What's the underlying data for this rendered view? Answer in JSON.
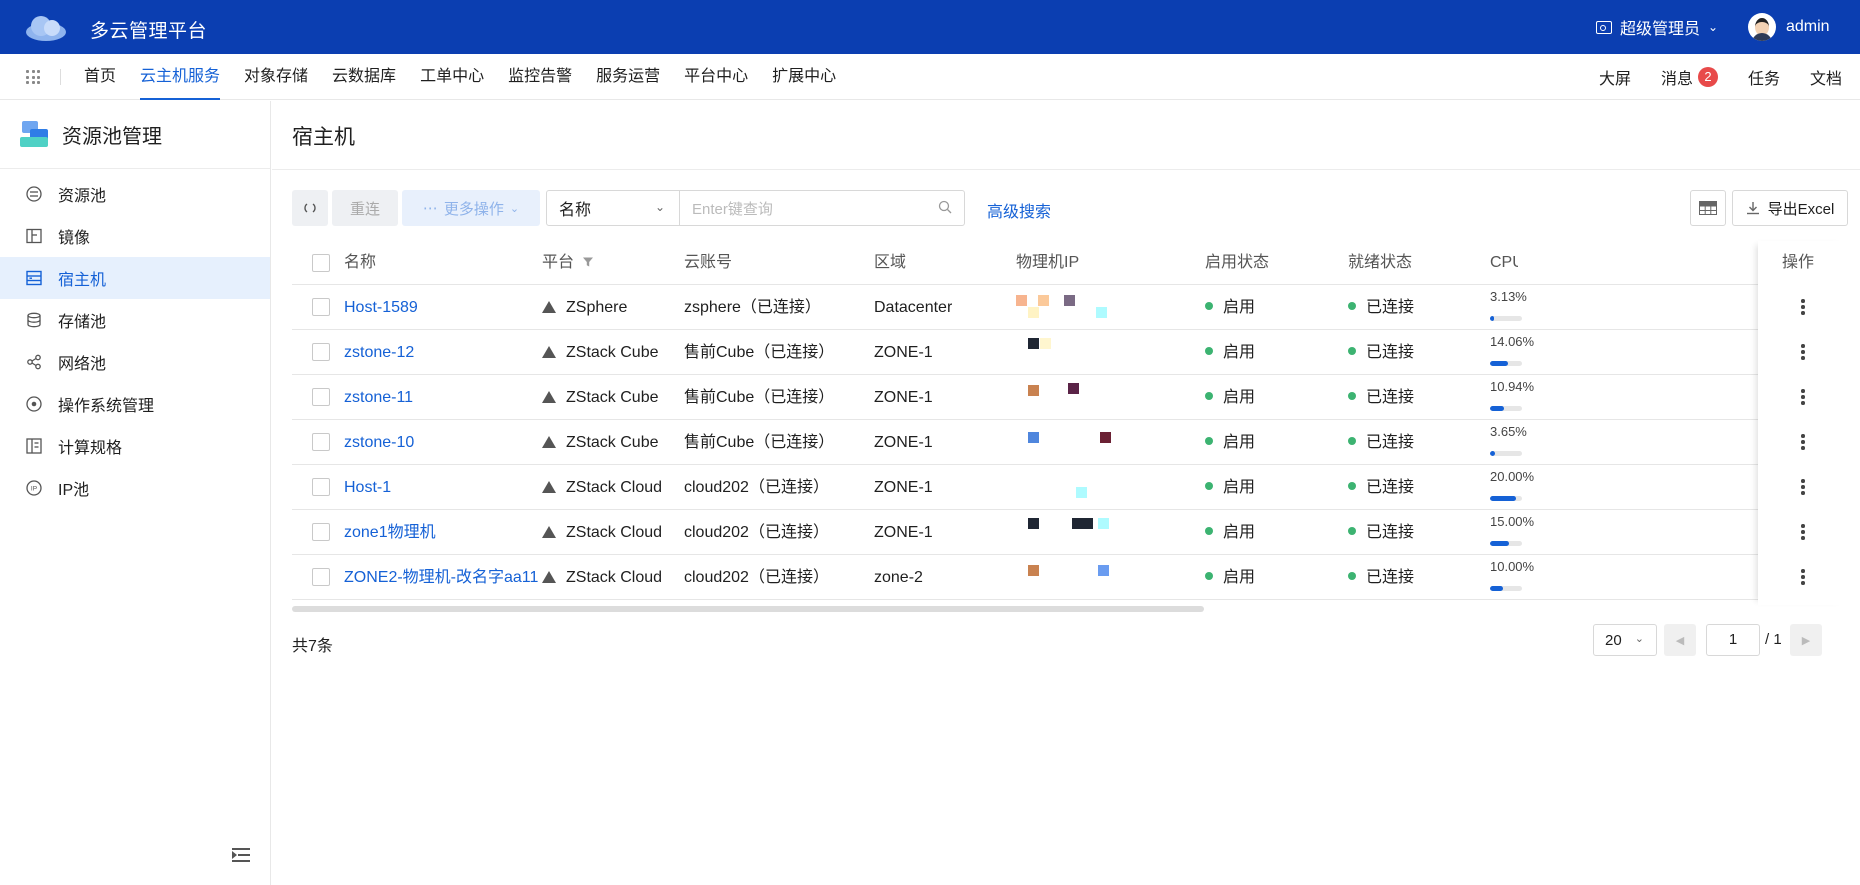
{
  "app": {
    "title": "多云管理平台",
    "role": "超级管理员",
    "user": "admin"
  },
  "nav": {
    "items": [
      "首页",
      "云主机服务",
      "对象存储",
      "云数据库",
      "工单中心",
      "监控告警",
      "服务运营",
      "平台中心",
      "扩展中心"
    ],
    "active_index": 1,
    "right": {
      "screen": "大屏",
      "messages": "消息",
      "message_count": "2",
      "tasks": "任务",
      "docs": "文档"
    }
  },
  "sidebar": {
    "title": "资源池管理",
    "items": [
      {
        "label": "资源池",
        "icon": "resource-pool-icon"
      },
      {
        "label": "镜像",
        "icon": "image-icon"
      },
      {
        "label": "宿主机",
        "icon": "host-icon"
      },
      {
        "label": "存储池",
        "icon": "storage-icon"
      },
      {
        "label": "网络池",
        "icon": "network-icon"
      },
      {
        "label": "操作系统管理",
        "icon": "os-icon"
      },
      {
        "label": "计算规格",
        "icon": "spec-icon"
      },
      {
        "label": "IP池",
        "icon": "ip-icon"
      }
    ],
    "active_index": 2
  },
  "page": {
    "title": "宿主机",
    "toolbar": {
      "reconnect": "重连",
      "more_actions": "更多操作",
      "search_field": "名称",
      "search_placeholder": "Enter键查询",
      "advanced_search": "高级搜索",
      "export": "导出Excel"
    },
    "table": {
      "columns": [
        "名称",
        "平台",
        "云账号",
        "区域",
        "物理机IP",
        "启用状态",
        "就绪状态",
        "CPU",
        "操作"
      ],
      "rows": [
        {
          "name": "Host-1589",
          "platform": "ZSphere",
          "account": "zsphere（已连接）",
          "zone": "Datacenter",
          "enabled": "启用",
          "ready": "已连接",
          "cpu": "3.13%",
          "cpu_pct": 3.13
        },
        {
          "name": "zstone-12",
          "platform": "ZStack Cube",
          "account": "售前Cube（已连接）",
          "zone": "ZONE-1",
          "enabled": "启用",
          "ready": "已连接",
          "cpu": "14.06%",
          "cpu_pct": 14.06
        },
        {
          "name": "zstone-11",
          "platform": "ZStack Cube",
          "account": "售前Cube（已连接）",
          "zone": "ZONE-1",
          "enabled": "启用",
          "ready": "已连接",
          "cpu": "10.94%",
          "cpu_pct": 10.94
        },
        {
          "name": "zstone-10",
          "platform": "ZStack Cube",
          "account": "售前Cube（已连接）",
          "zone": "ZONE-1",
          "enabled": "启用",
          "ready": "已连接",
          "cpu": "3.65%",
          "cpu_pct": 3.65
        },
        {
          "name": "Host-1",
          "platform": "ZStack Cloud",
          "account": "cloud202（已连接）",
          "zone": "ZONE-1",
          "enabled": "启用",
          "ready": "已连接",
          "cpu": "20.00%",
          "cpu_pct": 20.0
        },
        {
          "name": "zone1物理机",
          "platform": "ZStack Cloud",
          "account": "cloud202（已连接）",
          "zone": "ZONE-1",
          "enabled": "启用",
          "ready": "已连接",
          "cpu": "15.00%",
          "cpu_pct": 15.0
        },
        {
          "name": "ZONE2-物理机-改名字aa11",
          "platform": "ZStack Cloud",
          "account": "cloud202（已连接）",
          "zone": "zone-2",
          "enabled": "启用",
          "ready": "已连接",
          "cpu": "10.00%",
          "cpu_pct": 10.0
        }
      ]
    },
    "pagination": {
      "total": "共7条",
      "page_size": "20",
      "current": "1",
      "total_pages": "/ 1"
    }
  },
  "colors": {
    "header": "#0b3eb1",
    "accent": "#1561d6",
    "status_ok": "#3cb371",
    "badge": "#e84a4a"
  }
}
